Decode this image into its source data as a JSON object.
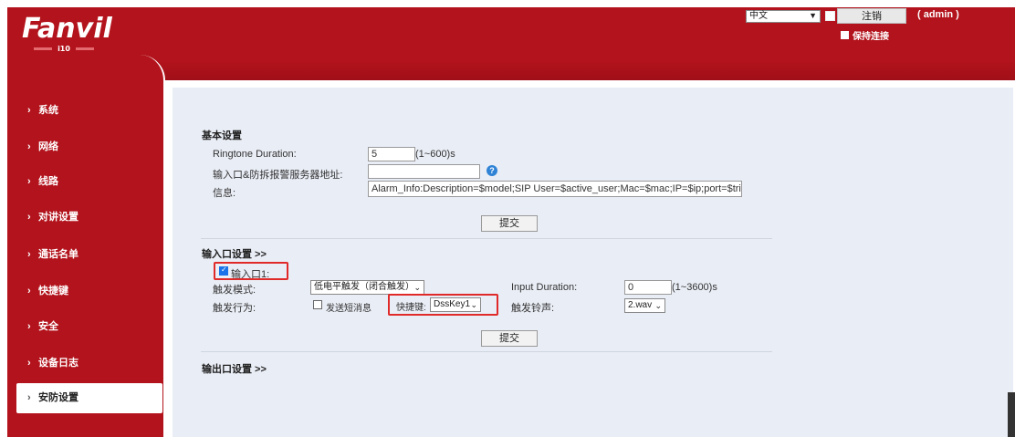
{
  "header": {
    "logo": "Fanvil",
    "model": "i10",
    "language": "中文",
    "logout_label": "注销",
    "user_label": "( admin )",
    "keep_connected_label": "保持连接"
  },
  "sidebar": {
    "items": [
      {
        "label": "系统"
      },
      {
        "label": "网络"
      },
      {
        "label": "线路"
      },
      {
        "label": "对讲设置"
      },
      {
        "label": "通话名单"
      },
      {
        "label": "快捷键"
      },
      {
        "label": "安全"
      },
      {
        "label": "设备日志"
      },
      {
        "label": "安防设置"
      }
    ],
    "chevron": "›",
    "active_index": 8
  },
  "basic": {
    "title": "基本设置",
    "ringtone_label": "Ringtone Duration:",
    "ringtone_value": "5",
    "ringtone_hint": "(1~600)s",
    "server_label": "输入口&防拆报警服务器地址:",
    "server_value": "",
    "info_label": "信息:",
    "info_value": "Alarm_Info:Description=$model;SIP User=$active_user;Mac=$mac;IP=$ip;port=$trigge",
    "submit_label": "提交",
    "help_icon": "?"
  },
  "input_port": {
    "title": "输入口设置 >>",
    "port_label": "输入口1:",
    "port_checked": true,
    "trigger_mode_label": "触发模式:",
    "trigger_mode_value": "低电平触发（闭合触发）",
    "input_duration_label": "Input Duration:",
    "input_duration_value": "0",
    "input_duration_hint": "(1~3600)s",
    "trigger_action_label": "触发行为:",
    "send_sms_label": "发送短消息",
    "hotkey_label": "快捷键:",
    "hotkey_value": "DssKey1",
    "ring_label": "触发铃声:",
    "ring_value": "2.wav",
    "submit_label": "提交"
  },
  "output_port": {
    "title": "输出口设置 >>"
  },
  "colors": {
    "brand_red": "#b3131c",
    "panel_bg": "#e9edf5",
    "highlight": "#e02a2a"
  }
}
